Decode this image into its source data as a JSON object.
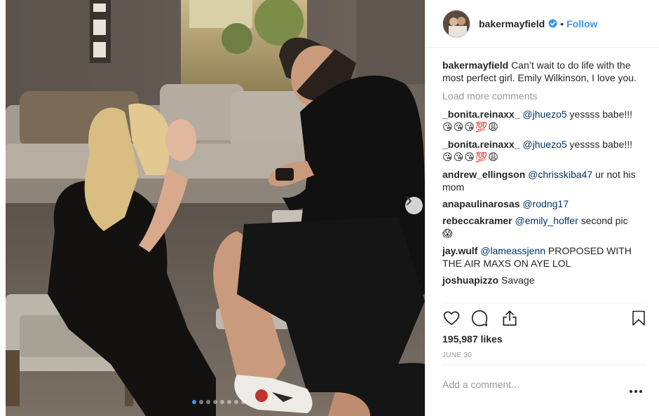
{
  "post": {
    "username": "bakermayfield",
    "follow_label": "Follow",
    "bullet": "•",
    "caption_user": "bakermayfield",
    "caption_text": "Can’t wait to do life with the most perfect girl. Emily Wilkinson, I love you.",
    "load_more": "Load more comments",
    "likes": "195,987 likes",
    "date": "JUNE 30",
    "add_comment_placeholder": "Add a comment...",
    "photo_index": 1,
    "photo_count": 8
  },
  "comments": [
    {
      "user": "_bonita.reinaxx_",
      "mention": "@jhuezo5",
      "text": "yessss babe!!!",
      "emoji": "😘😘😘💯😩"
    },
    {
      "user": "_bonita.reinaxx_",
      "mention": "@jhuezo5",
      "text": "yessss babe!!!",
      "emoji": "😘😘😘💯😩"
    },
    {
      "user": "andrew_ellingson",
      "mention": "@chrisskiba47",
      "text": "ur not his mom",
      "emoji": ""
    },
    {
      "user": "anapaulinarosas",
      "mention": "@rodng17",
      "text": "",
      "emoji": ""
    },
    {
      "user": "rebeccakramer",
      "mention": "@emily_hoffer",
      "text": "second pic",
      "emoji": "😱"
    },
    {
      "user": "jay.wulf",
      "mention": "@lameassjenn",
      "text": "PROPOSED WITH THE AIR MAXS ON AYE LOL",
      "emoji": ""
    },
    {
      "user": "joshuapizzo",
      "mention": "",
      "text": "Savage",
      "emoji": ""
    }
  ],
  "icons": {
    "like": "heart-icon",
    "comment": "comment-icon",
    "share": "share-icon",
    "save": "bookmark-icon",
    "verified": "verified-badge-icon",
    "next": "chevron-right-icon",
    "options": "more-options-icon"
  },
  "colors": {
    "link": "#3897f0",
    "mention": "#003569",
    "muted": "#999999",
    "text": "#262626",
    "verified": "#3897f0"
  }
}
